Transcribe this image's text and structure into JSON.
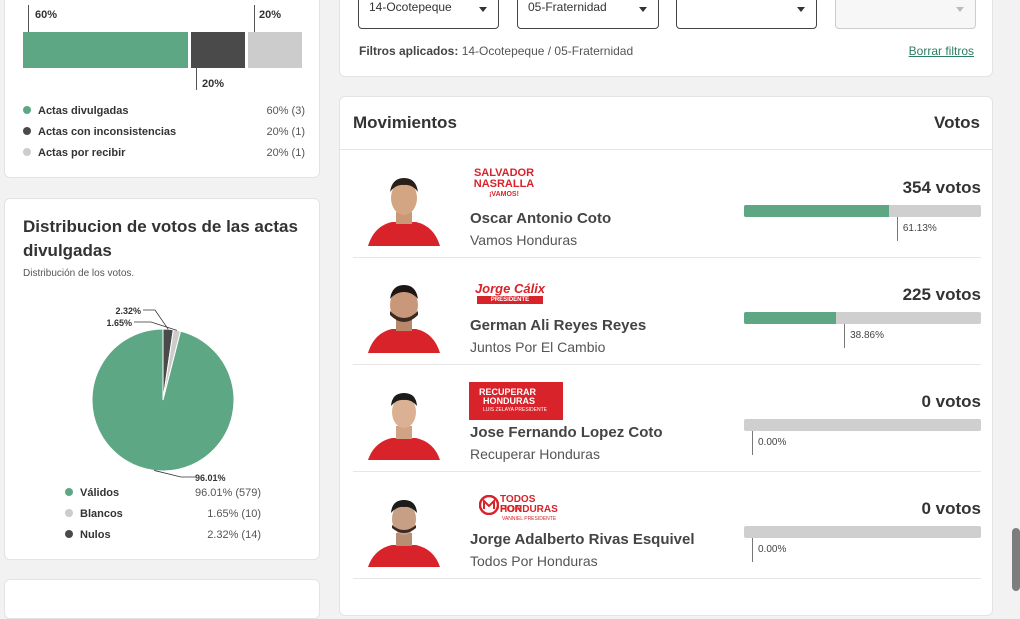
{
  "actas": {
    "bar_top_labels": [
      "60%",
      "20%"
    ],
    "bar_bottom_label": "20%",
    "segments": [
      {
        "name": "Actas divulgadas",
        "pct": 60,
        "color": "#5ea785"
      },
      {
        "name": "Actas con inconsistencias",
        "pct": 20,
        "color": "#4a4a4a"
      },
      {
        "name": "Actas por recibir",
        "pct": 20,
        "color": "#cccccc"
      }
    ],
    "legend": [
      {
        "label": "Actas divulgadas",
        "value": "60% (3)",
        "color": "#5ea785"
      },
      {
        "label": "Actas con inconsistencias",
        "value": "20% (1)",
        "color": "#4a4a4a"
      },
      {
        "label": "Actas por recibir",
        "value": "20% (1)",
        "color": "#cccccc"
      }
    ]
  },
  "pie_card": {
    "title": "Distribucion de votos de las actas divulgadas",
    "subtitle": "Distribución de los votos.",
    "slice_labels": {
      "valid": "96.01%",
      "blank": "1.65%",
      "null": "2.32%"
    },
    "legend": [
      {
        "label": "Válidos",
        "value": "96.01% (579)",
        "color": "#5ea785"
      },
      {
        "label": "Blancos",
        "value": "1.65% (10)",
        "color": "#cccccc"
      },
      {
        "label": "Nulos",
        "value": "2.32% (14)",
        "color": "#4a4a4a"
      }
    ]
  },
  "chart_data": {
    "type": "pie",
    "labels": [
      "Válidos",
      "Blancos",
      "Nulos"
    ],
    "values": [
      96.01,
      1.65,
      2.32
    ],
    "counts": [
      579,
      10,
      14
    ],
    "colors": [
      "#5ea785",
      "#cccccc",
      "#4a4a4a"
    ]
  },
  "filters": {
    "selects": [
      {
        "value": "14-Ocotepeque",
        "disabled": false
      },
      {
        "value": "05-Fraternidad",
        "disabled": false
      },
      {
        "value": "",
        "disabled": false
      },
      {
        "value": "",
        "disabled": true
      }
    ],
    "applied_label": "Filtros aplicados:",
    "applied_value": "14-Ocotepeque / 05-Fraternidad",
    "clear_label": "Borrar filtros"
  },
  "movimientos": {
    "title": "Movimientos",
    "votes_header": "Votos",
    "candidates": [
      {
        "name": "Oscar Antonio Coto",
        "party": "Vamos Honduras",
        "votes": "354 votos",
        "pct_label": "61.13%",
        "pct": 61.13,
        "logo_line1": "SALVADOR",
        "logo_line2": "NASRALLA",
        "logo_line3": "¡VAMOS!"
      },
      {
        "name": "German Ali Reyes Reyes",
        "party": "Juntos Por El Cambio",
        "votes": "225 votos",
        "pct_label": "38.86%",
        "pct": 38.86,
        "logo_line1": "Jorge Cálix",
        "logo_line2": "PRESIDENTE",
        "logo_line3": ""
      },
      {
        "name": "Jose Fernando Lopez Coto",
        "party": "Recuperar Honduras",
        "votes": "0 votos",
        "pct_label": "0.00%",
        "pct": 0,
        "logo_line1": "RECUPERAR",
        "logo_line2": "HONDURAS",
        "logo_line3": "LUIS ZELAYA PRESIDENTE"
      },
      {
        "name": "Jorge Adalberto Rivas Esquivel",
        "party": "Todos Por Honduras",
        "votes": "0 votos",
        "pct_label": "0.00%",
        "pct": 0,
        "logo_line1": "TODOS POR",
        "logo_line2": "HONDURAS",
        "logo_line3": "VANNIEL PRESIDENTE"
      }
    ]
  }
}
